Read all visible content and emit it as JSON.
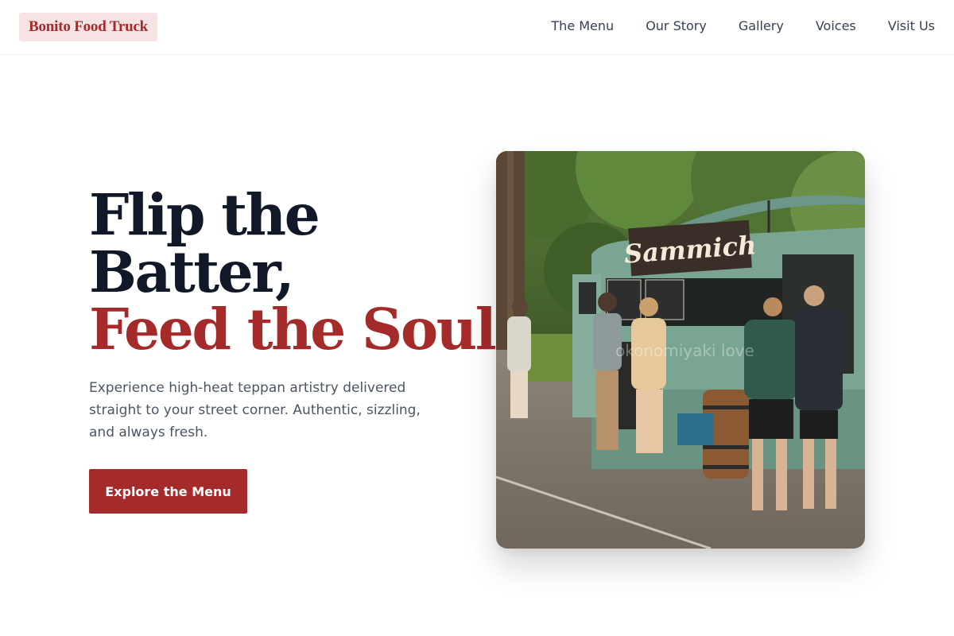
{
  "header": {
    "logo_text": "Bonito Food Truck",
    "nav": [
      {
        "label": "The Menu"
      },
      {
        "label": "Our Story"
      },
      {
        "label": "Gallery"
      },
      {
        "label": "Voices"
      },
      {
        "label": "Visit Us"
      }
    ]
  },
  "hero": {
    "title_line1": "Flip the",
    "title_line2": "Batter,",
    "title_line3": "Feed the Soul.",
    "subtitle": "Experience high-heat teppan artistry delivered straight to your street corner. Authentic, sizzling, and always fresh.",
    "cta_label": "Explore the Menu",
    "photo": {
      "sign_text": "Sammich",
      "watermark": "okonomiyaki love"
    }
  },
  "colors": {
    "accent": "#a52a2a",
    "logo_bg": "#f6e3e3",
    "heading": "#111827",
    "body_text": "#4b5563"
  }
}
